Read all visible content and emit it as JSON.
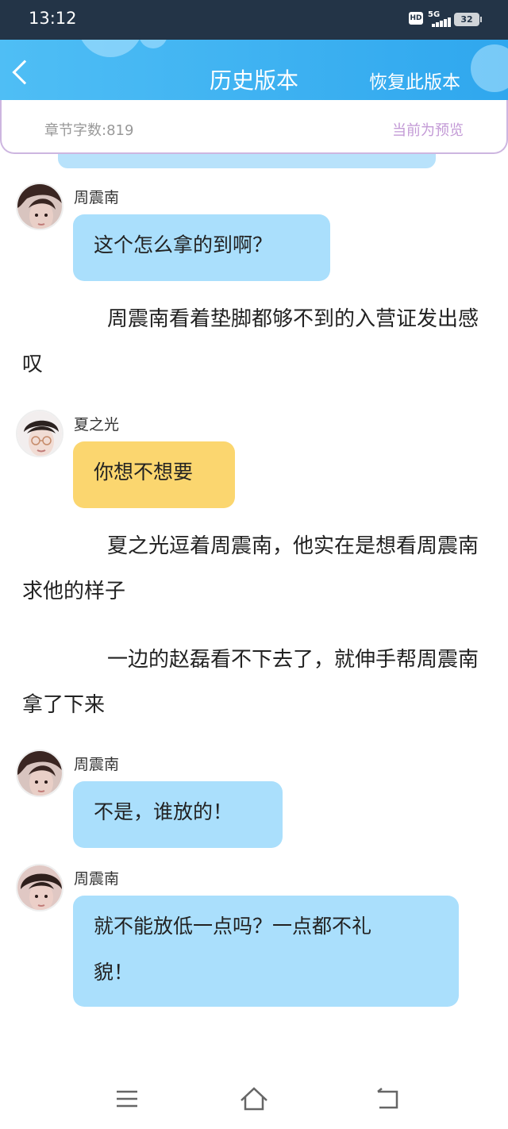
{
  "status": {
    "time": "13:12",
    "hd": "HD",
    "network": "5G",
    "battery": "32"
  },
  "header": {
    "title": "历史版本",
    "restore": "恢复此版本"
  },
  "info": {
    "word_count": "章节字数:819",
    "preview": "当前为预览"
  },
  "messages": [
    {
      "speaker": "周震南",
      "text": "这个怎么拿的到啊？"
    },
    {
      "speaker": "夏之光",
      "text": "你想不想要"
    },
    {
      "speaker": "周震南",
      "text": "不是，谁放的！"
    },
    {
      "speaker": "周震南",
      "text_line1": "就不能放低一点吗？一点都不礼",
      "text_line2": "貌！"
    }
  ],
  "paragraphs": [
    "周震南看着垫脚都够不到的入营证发出感叹",
    "夏之光逗着周震南，他实在是想看周震南求他的样子",
    "一边的赵磊看不下去了，就伸手帮周震南拿了下来"
  ],
  "colors": {
    "header": "#2fa7ee",
    "bubble_blue": "#aadffc",
    "bubble_yellow": "#fbd66f",
    "preview_text": "#c39ad6"
  },
  "icons": {
    "back": "chevron-left-icon",
    "menu": "menu-icon",
    "home": "home-icon",
    "return": "back-icon"
  }
}
